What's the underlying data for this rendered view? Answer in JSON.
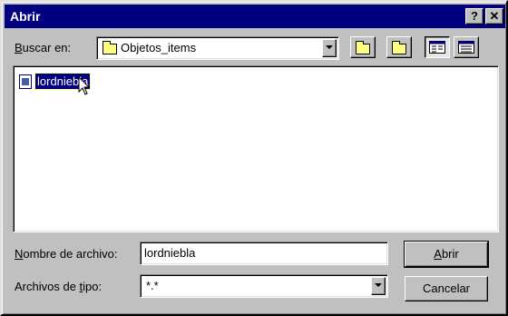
{
  "window": {
    "title": "Abrir",
    "help_label": "?",
    "close_label": "✕"
  },
  "lookin": {
    "label_prefix": "B",
    "label_rest": "uscar en:",
    "value": "Objetos_items"
  },
  "toolbar": {
    "icons": [
      "up-one-level-icon",
      "new-folder-icon",
      "list-view-icon",
      "details-view-icon"
    ]
  },
  "files": [
    {
      "name": "lordniebla",
      "selected": true
    }
  ],
  "filename": {
    "label_prefix": "N",
    "label_rest": "ombre de archivo:",
    "value": "lordniebla"
  },
  "filetype": {
    "label_prefix": "Archivos de ",
    "label_key": "t",
    "label_rest": "ipo:",
    "value": "*.*"
  },
  "buttons": {
    "open_prefix": "A",
    "open_rest": "brir",
    "cancel": "Cancelar"
  },
  "colors": {
    "titlebar": "#000080",
    "face": "#c0c0c0",
    "selection": "#000080"
  }
}
